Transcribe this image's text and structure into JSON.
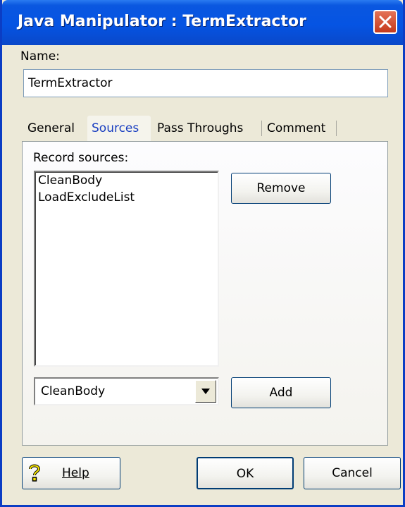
{
  "window": {
    "title": "Java Manipulator : TermExtractor"
  },
  "name_field": {
    "label": "Name:",
    "value": "TermExtractor"
  },
  "tabs": [
    {
      "label": "General"
    },
    {
      "label": "Sources"
    },
    {
      "label": "Pass Throughs"
    },
    {
      "label": "Comment"
    }
  ],
  "sources": {
    "label": "Record sources:",
    "items": [
      "CleanBody",
      "LoadExcludeList"
    ],
    "remove_label": "Remove",
    "add_label": "Add",
    "select_value": "CleanBody"
  },
  "footer": {
    "help_label": "Help",
    "ok_label": "OK",
    "cancel_label": "Cancel"
  },
  "colors": {
    "titlebar": "#0554e3",
    "active_tab_text": "#1a3fc1",
    "dialog_bg": "#ece9d8"
  }
}
